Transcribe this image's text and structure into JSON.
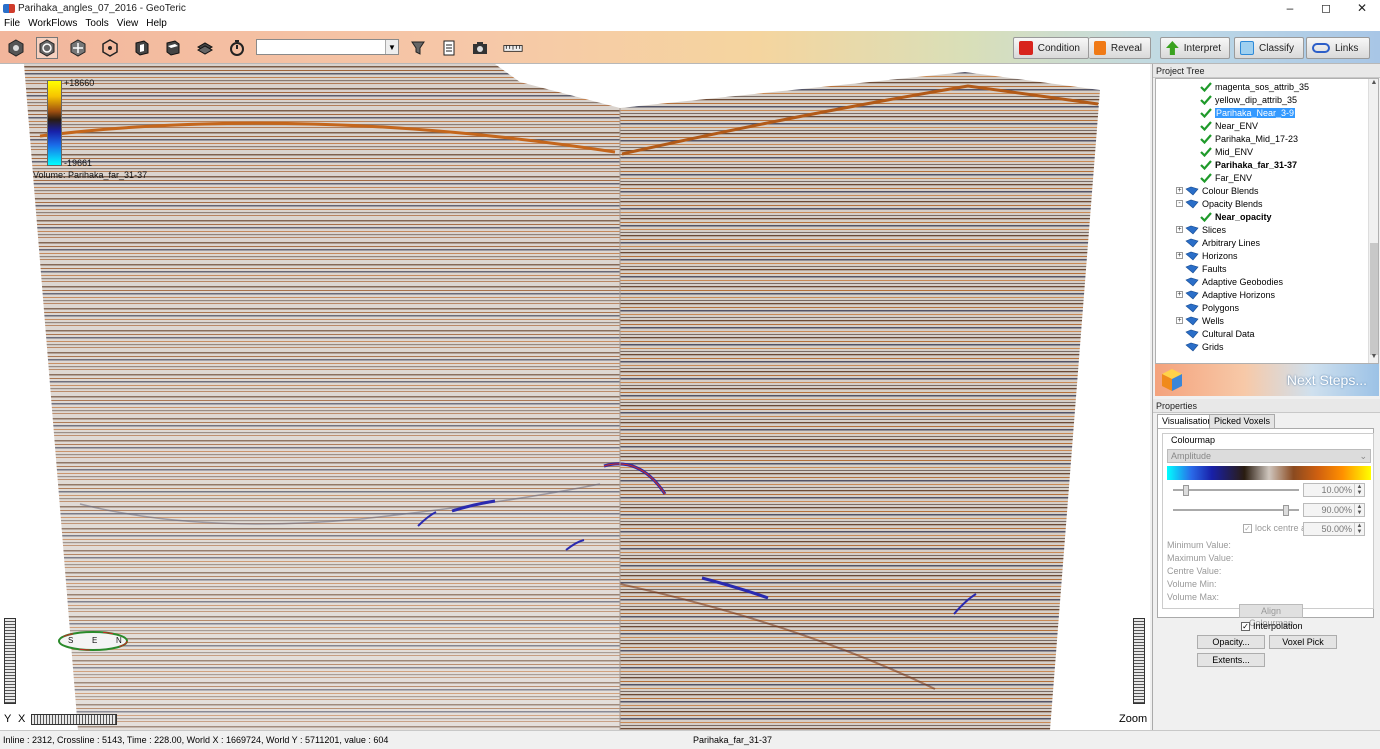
{
  "window": {
    "title": "Parihaka_angles_07_2016 - GeoTeric"
  },
  "menu": [
    "File",
    "WorkFlows",
    "Tools",
    "View",
    "Help"
  ],
  "toolbar": {
    "scene_select_value": "",
    "icons": [
      "reset-view-icon",
      "rotate-view-icon",
      "orbit-icon",
      "pan-icon",
      "inline-icon",
      "crossline-icon",
      "timeslice-icon",
      "timer-icon",
      "filter-icon",
      "notes-icon",
      "camera-icon",
      "ruler-icon"
    ]
  },
  "workflows": [
    {
      "label": "Condition",
      "color": "#d8231c"
    },
    {
      "label": "Reveal",
      "color": "#f07a16"
    },
    {
      "label": "Interpret",
      "color": "#3aa21f"
    },
    {
      "label": "Classify",
      "color": "#2e8ad8"
    },
    {
      "label": "Links",
      "color": "#2c5ec8"
    }
  ],
  "viewport": {
    "colorbar_max": "+18660",
    "colorbar_min": "-19661",
    "volume_label": "Volume: Parihaka_far_31-37",
    "axis_y": "Y",
    "axis_x": "X",
    "zoom": "Zoom",
    "compass_letters": [
      "S",
      "E",
      "N"
    ]
  },
  "project_tree": {
    "header": "Project Tree",
    "items": [
      {
        "label": "magenta_sos_attrib_35",
        "kind": "check",
        "level": 2
      },
      {
        "label": "yellow_dip_attrib_35",
        "kind": "check",
        "level": 2
      },
      {
        "label": "Parihaka_Near_3-9",
        "kind": "check",
        "level": 2,
        "selected": true
      },
      {
        "label": "Near_ENV",
        "kind": "check",
        "level": 2
      },
      {
        "label": "Parihaka_Mid_17-23",
        "kind": "check",
        "level": 2
      },
      {
        "label": "Mid_ENV",
        "kind": "check",
        "level": 2
      },
      {
        "label": "Parihaka_far_31-37",
        "kind": "check",
        "level": 2,
        "bold": true
      },
      {
        "label": "Far_ENV",
        "kind": "check",
        "level": 2
      },
      {
        "label": "Colour Blends",
        "kind": "folder",
        "level": 1,
        "expander": "+"
      },
      {
        "label": "Opacity Blends",
        "kind": "folder",
        "level": 1,
        "expander": "-"
      },
      {
        "label": "Near_opacity",
        "kind": "check",
        "level": 2,
        "bold": true
      },
      {
        "label": "Slices",
        "kind": "folder",
        "level": 1,
        "expander": "+"
      },
      {
        "label": "Arbitrary Lines",
        "kind": "folder",
        "level": 1
      },
      {
        "label": "Horizons",
        "kind": "folder",
        "level": 1,
        "expander": "+"
      },
      {
        "label": "Faults",
        "kind": "folder",
        "level": 1
      },
      {
        "label": "Adaptive Geobodies",
        "kind": "folder",
        "level": 1
      },
      {
        "label": "Adaptive Horizons",
        "kind": "folder",
        "level": 1,
        "expander": "+"
      },
      {
        "label": "Polygons",
        "kind": "folder",
        "level": 1
      },
      {
        "label": "Wells",
        "kind": "folder",
        "level": 1,
        "expander": "+"
      },
      {
        "label": "Cultural Data",
        "kind": "folder",
        "level": 1
      },
      {
        "label": "Grids",
        "kind": "folder",
        "level": 1
      }
    ]
  },
  "next_steps": {
    "label": "Next Steps..."
  },
  "properties": {
    "header": "Properties",
    "tabs": [
      "Visualisation",
      "Picked Voxels"
    ],
    "colourmap_title": "Colourmap",
    "colourmap_value": "Amplitude",
    "low_pct": "10.00%",
    "low_level": 0.1,
    "high_pct": "90.00%",
    "high_level": 0.9,
    "lock_centre_label": "lock centre at",
    "lock_centre_value": "50.00%",
    "fields": [
      "Minimum Value:",
      "Maximum Value:",
      "Centre Value:",
      "Volume Min:",
      "Volume Max:"
    ],
    "align_button": "Align Colourmap",
    "interpolation_label": "Interpolation",
    "buttons": {
      "opacity": "Opacity...",
      "voxel_pick": "Voxel Pick",
      "extents": "Extents..."
    }
  },
  "status": {
    "left": "Inline : 2312, Crossline : 5143, Time : 228.00, World X : 1669724, World Y : 5711201, value : 604",
    "right": "Parihaka_far_31-37"
  }
}
